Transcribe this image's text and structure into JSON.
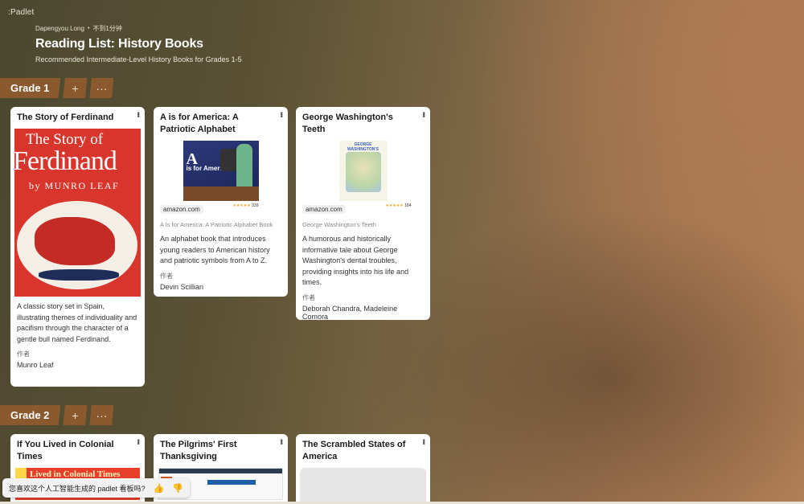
{
  "app": {
    "logo": ":Padlet"
  },
  "header": {
    "author": "Dapengyou Long",
    "separator": "•",
    "time": "不到1分钟",
    "title": "Reading List: History Books",
    "subtitle": "Recommended Intermediate-Level History Books for Grades 1-5"
  },
  "sections": [
    {
      "label": "Grade 1",
      "add_icon": "plus-icon",
      "more_icon": "more-horizontal-icon",
      "add_glyph": "+",
      "more_glyph": "···",
      "cards": [
        {
          "title": "The Story of Ferdinand",
          "cover": {
            "line1": "The Story of",
            "line2": "Ferdinand",
            "line3": "by MUNRO LEAF"
          },
          "description": "A classic story set in Spain, illustrating themes of individuality and pacifism through the character of a gentle bull named Ferdinand.",
          "author_label": "作者",
          "author": "Munro Leaf"
        },
        {
          "title": "A is for America: A Patriotic Alphabet",
          "thumb": {
            "letter": "A",
            "word": "is for America"
          },
          "source": "amazon.com",
          "rating": "★★★★★",
          "rating_count": "339",
          "caption": "A Is for America: A Patriotic Alphabet Book",
          "description": "An alphabet book that introduces young readers to American history and patriotic symbols from A to Z.",
          "author_label": "作者",
          "author": "Devin Scillian"
        },
        {
          "title": "George Washington's Teeth",
          "thumb": {
            "top": "GEORGE WASHINGTON'S TEETH"
          },
          "source": "amazon.com",
          "rating": "★★★★★",
          "rating_count": "184",
          "caption": "George Washington's Teeth",
          "description": "A humorous and historically informative tale about George Washington's dental troubles, providing insights into his life and times.",
          "author_label": "作者",
          "author": "Deborah Chandra, Madeleine Comora"
        }
      ]
    },
    {
      "label": "Grade 2",
      "add_glyph": "+",
      "more_glyph": "···",
      "cards": [
        {
          "title": "If You Lived in Colonial Times",
          "thumb_text": "Lived in Colonial Times"
        },
        {
          "title": "The Pilgrims' First Thanksgiving"
        },
        {
          "title": "The Scrambled States of America"
        }
      ]
    }
  ],
  "card_menu_glyph": "•••",
  "feedback": {
    "question": "您喜欢这个人工智能生成的 padlet 看板吗?",
    "like_icon": "thumbs-up-icon",
    "dislike_icon": "thumbs-down-icon",
    "like_glyph": "👍",
    "dislike_glyph": "👎"
  }
}
